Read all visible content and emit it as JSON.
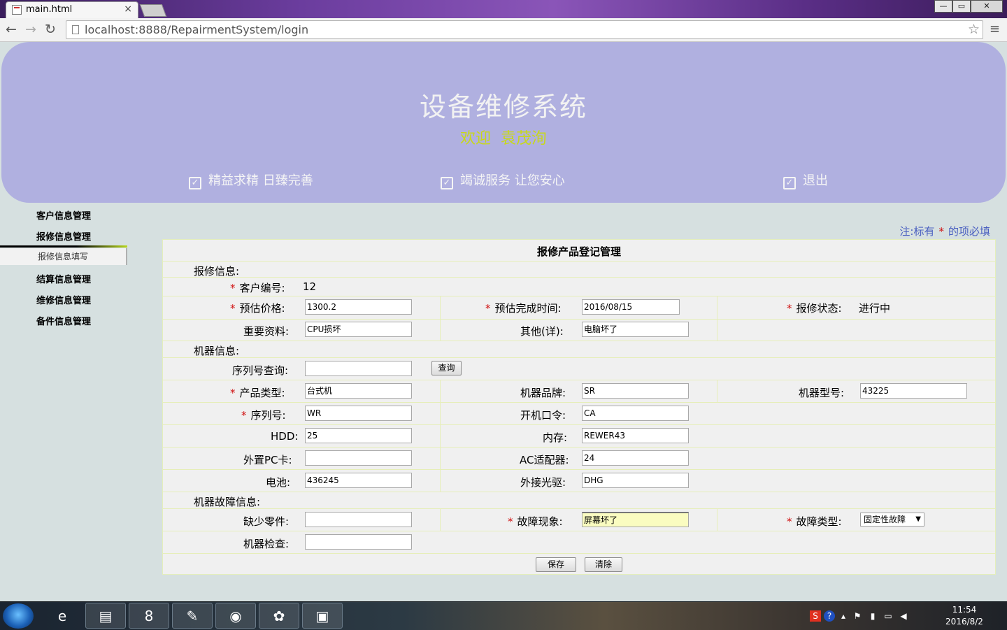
{
  "browser": {
    "tab_title": "main.html",
    "tab_close": "×",
    "url": "localhost:8888/RepairmentSystem/login",
    "back": "←",
    "forward": "→",
    "reload": "↻",
    "bookmark": "☆",
    "menu": "≡",
    "win_minimize": "—",
    "win_maximize": "▭",
    "win_close": "✕"
  },
  "header": {
    "system_title": "设备维修系统",
    "welcome": "欢迎",
    "user_name": "袁茂洵",
    "slogan1": "精益求精 日臻完善",
    "slogan2": "竭诚服务 让您安心",
    "logout": "退出",
    "check_glyph": "✓"
  },
  "sidebar": {
    "items": [
      {
        "label": "客户信息管理"
      },
      {
        "label": "报修信息管理"
      },
      {
        "label": "结算信息管理"
      },
      {
        "label": "维修信息管理"
      },
      {
        "label": "备件信息管理"
      }
    ],
    "sub_item": "报修信息填写"
  },
  "note": {
    "prefix": "注:标有",
    "star": "*",
    "suffix": "的项必填"
  },
  "form": {
    "title": "报修产品登记管理",
    "required_mark": "*",
    "sections": {
      "repair": "报修信息:",
      "machine": "机器信息:",
      "fault": "机器故障信息:"
    },
    "labels": {
      "customer_id": "客户编号:",
      "est_price": "预估价格:",
      "est_finish": "预估完成时间:",
      "repair_status": "报修状态:",
      "important_data": "重要资料:",
      "other": "其他(详):",
      "serial_query": "序列号查询:",
      "product_type": "产品类型:",
      "brand": "机器品牌:",
      "model": "机器型号:",
      "serial": "序列号:",
      "boot_password": "开机口令:",
      "hdd": "HDD:",
      "memory": "内存:",
      "pc_card": "外置PC卡:",
      "ac_adapter": "AC适配器:",
      "battery": "电池:",
      "optical": "外接光驱:",
      "missing_parts": "缺少零件:",
      "fault_symptom": "故障现象:",
      "fault_type": "故障类型:",
      "machine_check": "机器检查:"
    },
    "values": {
      "customer_id": "12",
      "est_price": "1300.2",
      "est_finish": "2016/08/15",
      "repair_status": "进行中",
      "important_data": "CPU损坏",
      "other": "电脑坏了",
      "serial_query": "",
      "product_type": "台式机",
      "brand": "SR",
      "model": "43225",
      "serial": "WR",
      "boot_password": "CA",
      "hdd": "25",
      "memory": "REWER43",
      "pc_card": "",
      "ac_adapter": "24",
      "battery": "436245",
      "optical": "DHG",
      "missing_parts": "",
      "fault_symptom": "屏幕坏了",
      "fault_type": "固定性故障",
      "machine_check": ""
    },
    "buttons": {
      "query": "查询",
      "save": "保存",
      "clear": "清除"
    }
  },
  "taskbar": {
    "time": "11:54",
    "date": "2016/8/2"
  }
}
